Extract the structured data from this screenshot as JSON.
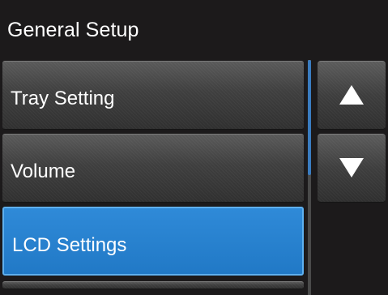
{
  "header": {
    "title": "General Setup"
  },
  "menu": {
    "items": [
      {
        "label": "Tray Setting"
      },
      {
        "label": "Volume"
      },
      {
        "label": "LCD Settings"
      }
    ]
  },
  "scroll": {
    "position_fraction": 0.0,
    "visible_fraction": 0.49
  },
  "controls": {
    "up_icon": "arrow-up-icon",
    "down_icon": "arrow-down-icon"
  },
  "colors": {
    "background": "#1c1a1b",
    "selected": "#2a82d0",
    "text": "#ffffff"
  }
}
